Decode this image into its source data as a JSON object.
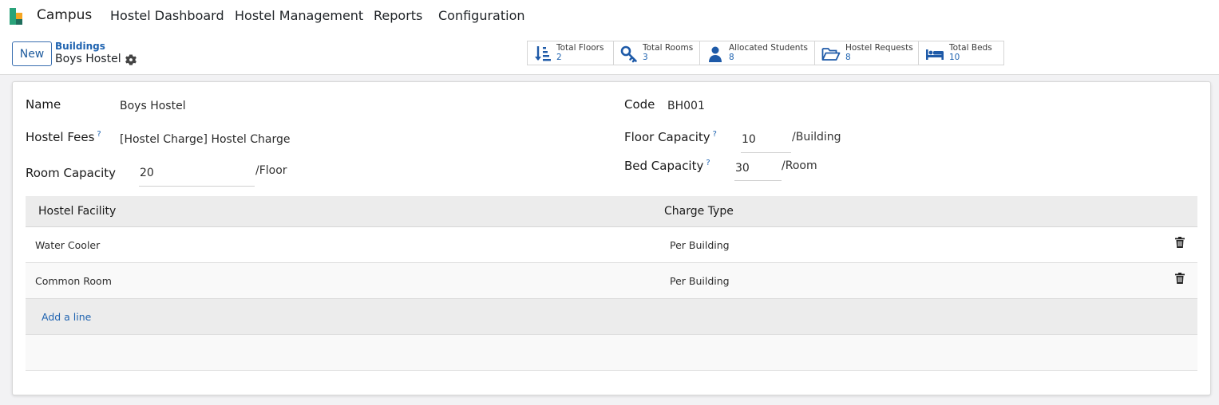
{
  "topbar": {
    "app_name": "Campus",
    "menu": [
      "Hostel Dashboard",
      "Hostel Management",
      "Reports",
      "Configuration"
    ],
    "logo_colors": [
      "#2aa37a",
      "#f6a623",
      "#1f6e5c"
    ]
  },
  "control": {
    "new_label": "New",
    "breadcrumb": "Buildings",
    "record_title": "Boys Hostel",
    "smart_buttons": [
      {
        "label": "Total Floors",
        "value": "2",
        "icon": "sort-down-icon"
      },
      {
        "label": "Total Rooms",
        "value": "3",
        "icon": "key-icon"
      },
      {
        "label": "Allocated Students",
        "value": "8",
        "icon": "user-icon"
      },
      {
        "label": "Hostel Requests",
        "value": "8",
        "icon": "folder-open-icon"
      },
      {
        "label": "Total Beds",
        "value": "10",
        "icon": "bed-icon"
      }
    ]
  },
  "form": {
    "name_label": "Name",
    "name_value": "Boys Hostel",
    "code_label": "Code",
    "code_value": "BH001",
    "fees_label": "Hostel Fees",
    "fees_value": "[Hostel Charge] Hostel Charge",
    "floor_cap_label": "Floor Capacity",
    "floor_cap_value": "10",
    "floor_cap_unit": "/Building",
    "room_cap_label": "Room Capacity",
    "room_cap_value": "20",
    "room_cap_unit": "/Floor",
    "bed_cap_label": "Bed Capacity",
    "bed_cap_value": "30",
    "bed_cap_unit": "/Room",
    "help_mark": "?"
  },
  "table": {
    "columns": [
      "Hostel Facility",
      "Charge Type"
    ],
    "rows": [
      {
        "facility": "Water Cooler",
        "charge": "Per Building"
      },
      {
        "facility": "Common Room",
        "charge": "Per Building"
      }
    ],
    "add_line": "Add a line"
  },
  "colors": {
    "accent": "#1f63b0",
    "icon_blue": "#1e5aa8"
  }
}
